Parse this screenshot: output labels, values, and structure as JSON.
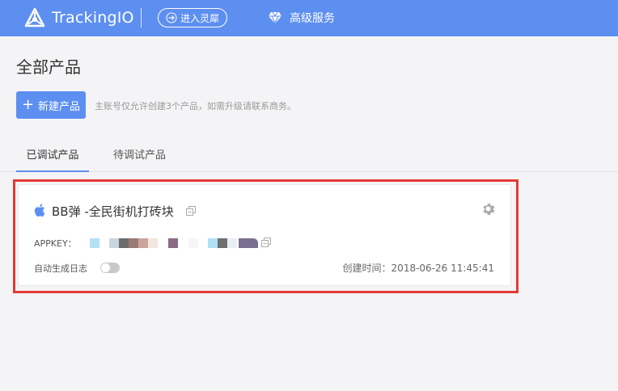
{
  "header": {
    "brand": "TrackingIO",
    "enter_label": "进入灵犀",
    "premium_label": "高级服务",
    "bg_color": "#5d8ff0"
  },
  "page": {
    "title": "全部产品",
    "new_button_label": "新建产品",
    "hint": "主账号仅允许创建3个产品，如需升级请联系商务。"
  },
  "tabs": [
    {
      "label": "已调试产品",
      "active": true
    },
    {
      "label": "待调试产品",
      "active": false
    }
  ],
  "product": {
    "platform_icon": "apple-icon",
    "name": "BB弹 -全民街机打砖块",
    "appkey_label": "APPKEY：",
    "appkey_value_note": "mosaic-redacted",
    "auto_log_label": "自动生成日志",
    "auto_log_enabled": false,
    "created_label": "创建时间：2018-06-26 11:45:41"
  },
  "colors": {
    "accent": "#5d8ff0",
    "highlight": "#e53935"
  }
}
